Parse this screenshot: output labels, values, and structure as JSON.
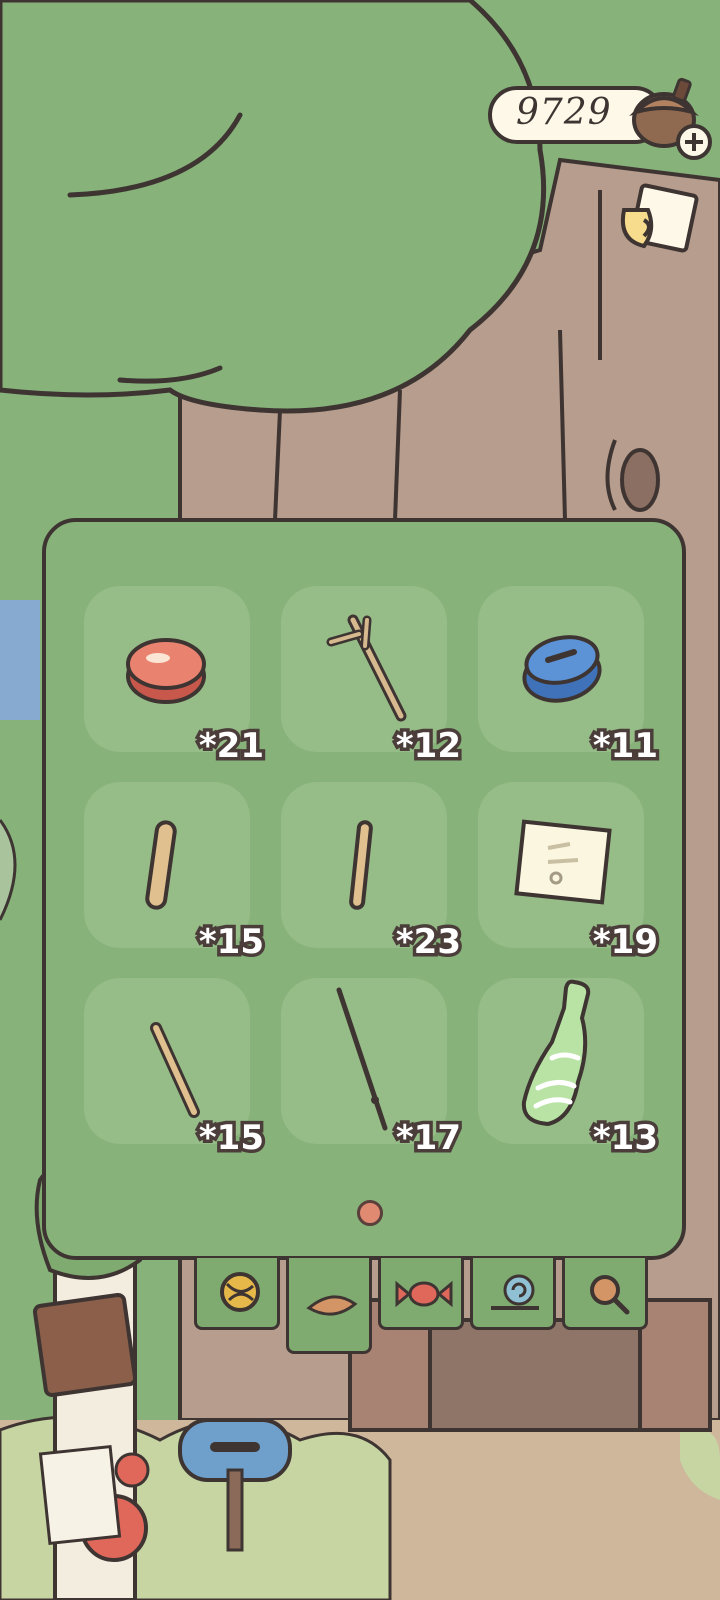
{
  "hud": {
    "acorn_count": "9729"
  },
  "inventory": {
    "items": [
      {
        "name": "red-bottle-cap-icon",
        "count": "*21"
      },
      {
        "name": "twig-icon",
        "count": "*12"
      },
      {
        "name": "blue-bottle-cap-icon",
        "count": "*11"
      },
      {
        "name": "ice-cream-stick-icon",
        "count": "*15"
      },
      {
        "name": "stick-icon",
        "count": "*23"
      },
      {
        "name": "paper-note-icon",
        "count": "*19"
      },
      {
        "name": "chopstick-icon",
        "count": "*15"
      },
      {
        "name": "thin-stick-icon",
        "count": "*17"
      },
      {
        "name": "glass-bottle-icon",
        "count": "*13"
      }
    ],
    "pages": 1,
    "current_page": 1
  },
  "shop_banners": [
    "yarn-ball-icon",
    "leaf-icon",
    "candy-icon",
    "snail-icon",
    "magnifier-icon"
  ],
  "colors": {
    "leaf_green": "#87b27a",
    "bark": "#b79d8d",
    "outline": "#3e3533",
    "slot": "#96bc88"
  }
}
